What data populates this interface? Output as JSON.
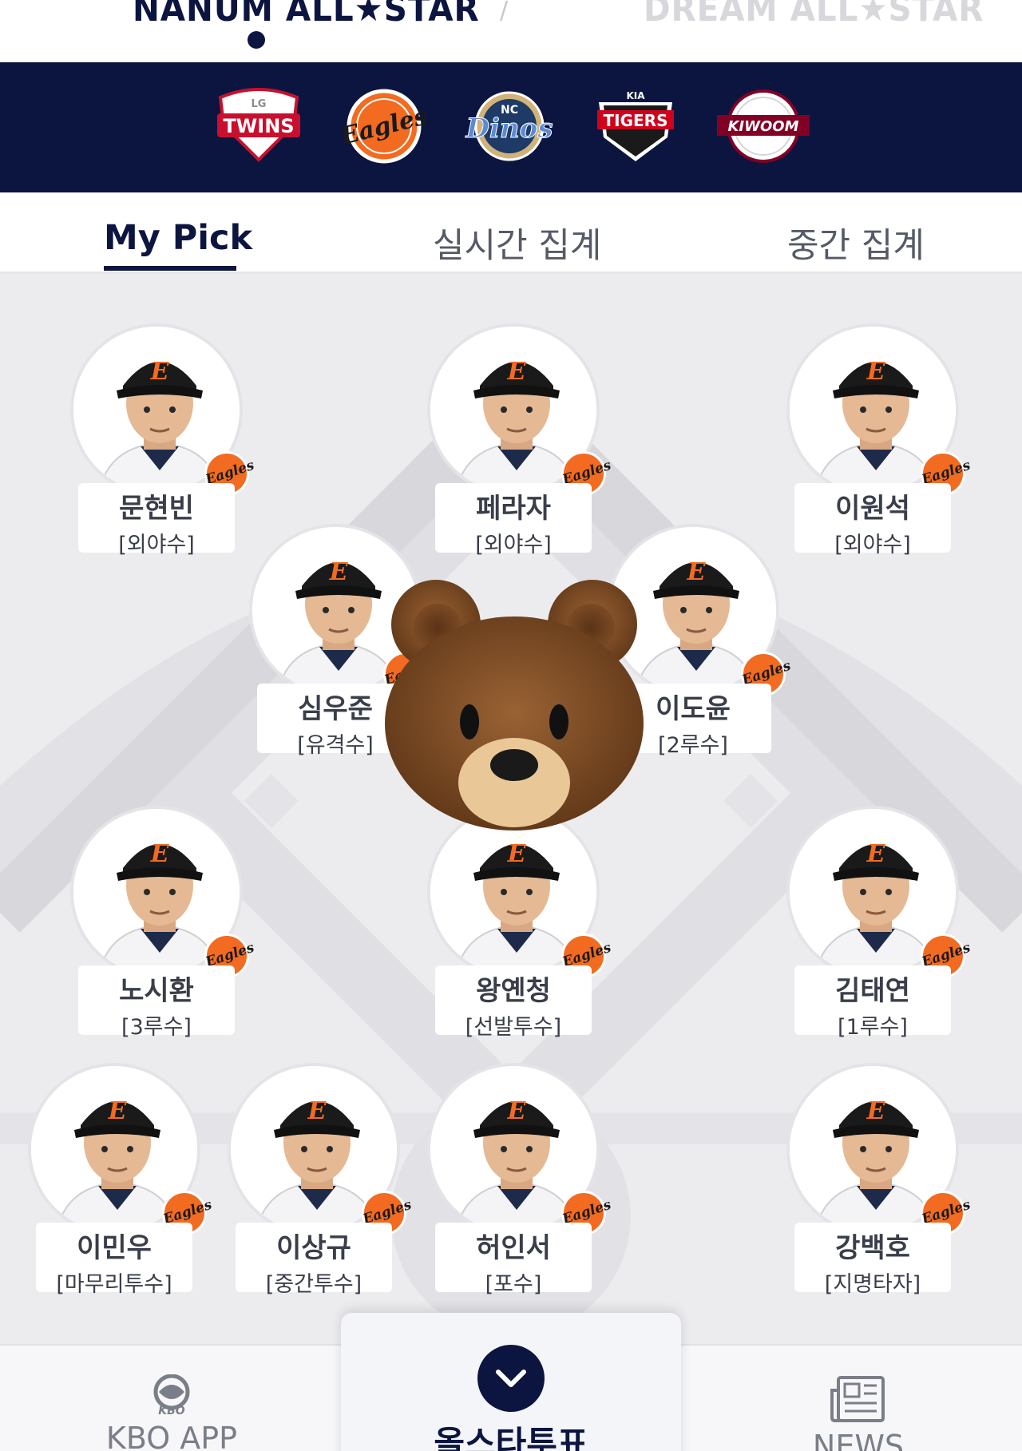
{
  "league_tabs": {
    "nanum": "NANUM ALL★STAR",
    "dream": "DREAM ALL★STAR",
    "separator": "/",
    "active": "nanum"
  },
  "teams": [
    {
      "id": "lg",
      "label": "TWINS",
      "sub": "LG",
      "icon": "lg-twins-logo"
    },
    {
      "id": "hanwha",
      "label": "Eagles",
      "icon": "hanwha-eagles-logo"
    },
    {
      "id": "nc",
      "label": "Dinos",
      "sub": "NC",
      "icon": "nc-dinos-logo"
    },
    {
      "id": "kia",
      "label": "TIGERS",
      "sub": "KIA",
      "icon": "kia-tigers-logo"
    },
    {
      "id": "kiwoom",
      "label": "KIWOOM",
      "icon": "kiwoom-heroes-logo"
    }
  ],
  "view_tabs": [
    {
      "label": "My Pick",
      "active": true
    },
    {
      "label": "실시간 집계",
      "active": false
    },
    {
      "label": "중간 집계",
      "active": false
    }
  ],
  "players": [
    {
      "name": "문현빈",
      "position": "[외야수]",
      "team": "Eagles"
    },
    {
      "name": "페라자",
      "position": "[외야수]",
      "team": "Eagles"
    },
    {
      "name": "이원석",
      "position": "[외야수]",
      "team": "Eagles"
    },
    {
      "name": "심우준",
      "position": "[유격수]",
      "team": "Eagles"
    },
    {
      "name": "이도윤",
      "position": "[2루수]",
      "team": "Eagles"
    },
    {
      "name": "노시환",
      "position": "[3루수]",
      "team": "Eagles"
    },
    {
      "name": "왕옌청",
      "position": "[선발투수]",
      "team": "Eagles"
    },
    {
      "name": "김태연",
      "position": "[1루수]",
      "team": "Eagles"
    },
    {
      "name": "이민우",
      "position": "[마무리투수]",
      "team": "Eagles"
    },
    {
      "name": "이상규",
      "position": "[중간투수]",
      "team": "Eagles"
    },
    {
      "name": "허인서",
      "position": "[포수]",
      "team": "Eagles"
    },
    {
      "name": "강백호",
      "position": "[지명타자]",
      "team": "Eagles"
    }
  ],
  "overlay": {
    "icon": "bear-emoji"
  },
  "bottom_nav": {
    "kbo_logo_text": "KBO",
    "kbo_app": "KBO APP",
    "vote": "올스타투표",
    "news": "NEWS"
  },
  "colors": {
    "navy": "#0c1540",
    "eagles_orange": "#f26b21",
    "field_bg": "#ececef"
  }
}
